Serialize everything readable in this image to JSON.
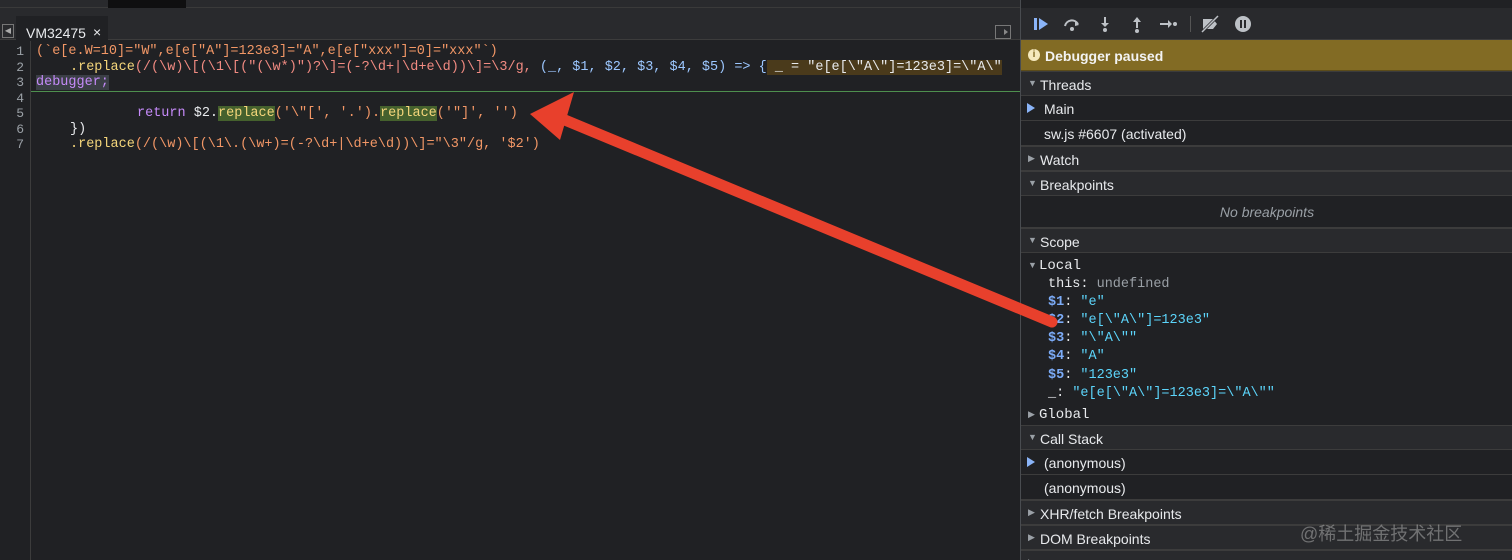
{
  "editor": {
    "tab_name": "VM32475",
    "tab_close": "×",
    "line_numbers": [
      "1",
      "2",
      "3",
      "4",
      "5",
      "6",
      "7"
    ],
    "lines": {
      "l1": "(`e[e.W=10]=\"W\",e[e[\"A\"]=123e3]=\"A\",e[e[\"xxx\"]=0]=\"xxx\"`)",
      "l2_method": ".replace",
      "l2_regex": "(/(\\w)\\[(\\1\\[(\"(\\w*)\")?\\]=(-?\\d+|\\d+e\\d))\\]=\\3/g, ",
      "l2_params": "(_, $1, $2, $3, $4, $5) => {",
      "l2_inline": " _ = \"e[e[\\\"A\\\"]=123e3]=\\\"A\\\"",
      "l3": "debugger;",
      "l5_return": "return ",
      "l5_var": "$2",
      "l5_call1": "replace",
      "l5_arg1": "('\\\"[', '.').",
      "l5_call2": "replace",
      "l5_arg2": "('\"]', '')",
      "l6": "})",
      "l7_method": ".replace",
      "l7_rest": "(/(\\w)\\[(\\1\\.(\\w+)=(-?\\d+|\\d+e\\d))\\]=\"\\3\"/g, '$2')"
    }
  },
  "debugger": {
    "toolbar_icons": [
      "resume-icon",
      "step-over-icon",
      "step-into-icon",
      "step-out-icon",
      "step-icon",
      "deactivate-breakpoints-icon",
      "pause-on-exceptions-icon"
    ],
    "paused_text": "Debugger paused",
    "threads": {
      "label": "Threads",
      "items": [
        "Main",
        "sw.js #6607 (activated)"
      ]
    },
    "watch_label": "Watch",
    "breakpoints": {
      "label": "Breakpoints",
      "empty": "No breakpoints"
    },
    "scope": {
      "label": "Scope",
      "local_label": "Local",
      "global_label": "Global",
      "entries": [
        {
          "key": "this",
          "value": "undefined"
        },
        {
          "key": "$1",
          "value": "\"e\""
        },
        {
          "key": "$2",
          "value": "\"e[\\\"A\\\"]=123e3\""
        },
        {
          "key": "$3",
          "value": "\"\\\"A\\\"\""
        },
        {
          "key": "$4",
          "value": "\"A\""
        },
        {
          "key": "$5",
          "value": "\"123e3\""
        },
        {
          "key": "_",
          "value": "\"e[e[\\\"A\\\"]=123e3]=\\\"A\\\"\""
        }
      ]
    },
    "call_stack": {
      "label": "Call Stack",
      "items": [
        "(anonymous)",
        "(anonymous)"
      ]
    },
    "xhr_label": "XHR/fetch Breakpoints",
    "dom_label": "DOM Breakpoints",
    "colors": {
      "banner": "#826b24",
      "annotation_arrow": "#e8402c"
    }
  },
  "watermark": "@稀土掘金技术社区"
}
